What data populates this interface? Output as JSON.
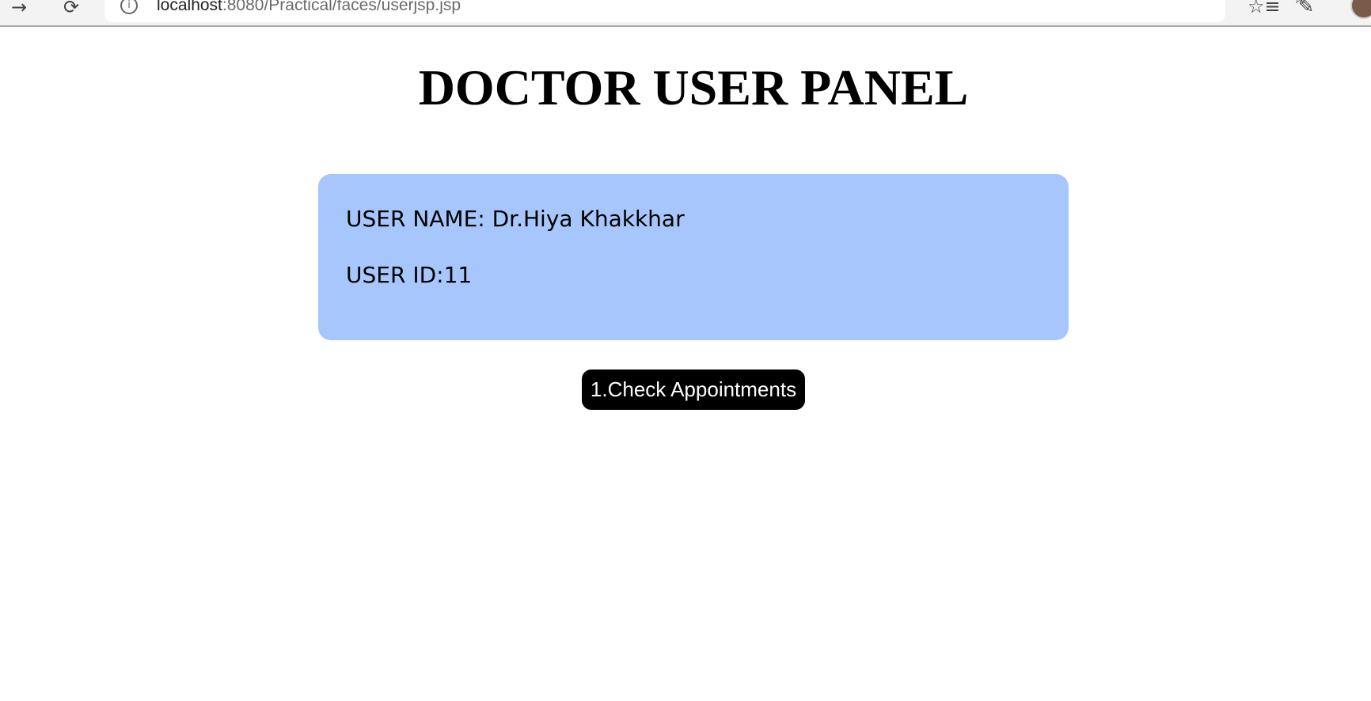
{
  "browser": {
    "url_host": "localhost",
    "url_rest": ":8080/Practical/faces/userjsp.jsp",
    "icons": {
      "back": "arrow-right-icon",
      "reload": "reload-icon",
      "info": "info-icon",
      "favorite": "add-favorite-icon",
      "collections": "favorites-list-icon",
      "extensions": "edit-note-icon",
      "profile": "avatar"
    }
  },
  "page": {
    "title": "DOCTOR USER PANEL",
    "user_card": {
      "name_line": "USER NAME: Dr.Hiya Khakkhar",
      "id_line": "USER ID:11",
      "background_color": "#a7c7fc"
    },
    "actions": {
      "check_appointments_label": "1.Check Appointments"
    }
  }
}
